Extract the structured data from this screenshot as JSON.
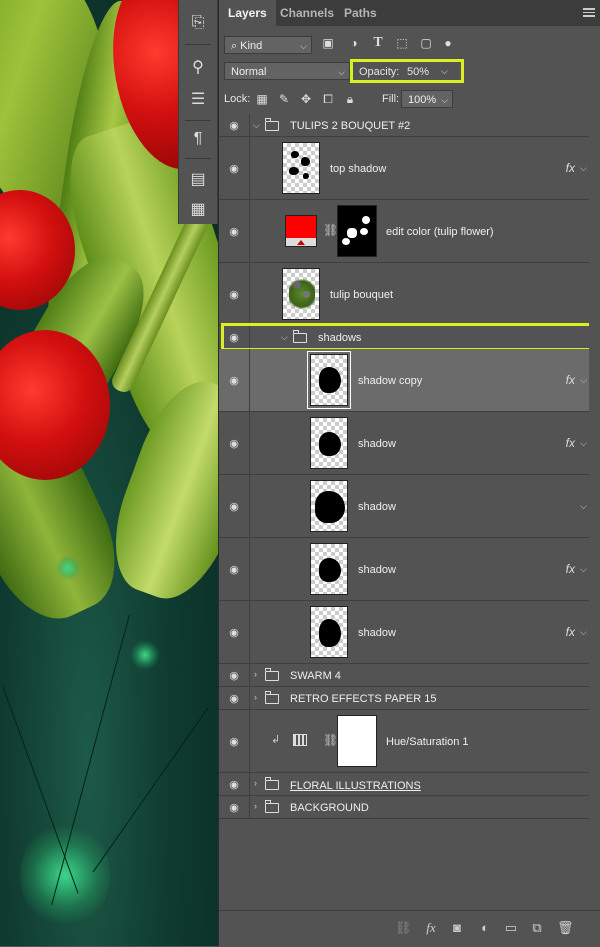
{
  "tabs": [
    {
      "label": "Layers",
      "active": true
    },
    {
      "label": "Channels",
      "active": false
    },
    {
      "label": "Paths",
      "active": false
    }
  ],
  "filter": {
    "kind_label": "Kind"
  },
  "blend": {
    "mode": "Normal",
    "opacity_label": "Opacity:",
    "opacity_value": "50%"
  },
  "lock": {
    "lock_label": "Lock:",
    "fill_label": "Fill:",
    "fill_value": "100%"
  },
  "layers": {
    "group_tulips": "TULIPS 2 BOUQUET #2",
    "top_shadow": "top shadow",
    "edit_color": "edit color (tulip flower)",
    "tulip_bouquet": "tulip bouquet",
    "group_shadows": "shadows",
    "shadow_copy": "shadow copy",
    "shadow_1": "shadow",
    "shadow_2": "shadow",
    "shadow_3": "shadow",
    "shadow_4": "shadow",
    "group_swarm": "SWARM 4",
    "group_retro": "RETRO EFFECTS PAPER 15",
    "hue_sat": "Hue/Saturation 1",
    "group_floral": "FLORAL ILLUSTRATIONS",
    "group_background": "BACKGROUND"
  },
  "fx_label": "fx",
  "colors": {
    "highlight": "#d9f020",
    "panel_bg": "#535353",
    "selected_row": "#6b6b6b",
    "swatch_red": "#ff0000"
  },
  "icons": [
    "eye-icon",
    "folder-icon",
    "link-icon",
    "fx-icon",
    "search-icon",
    "lock-icon",
    "trash-icon",
    "new-layer-icon",
    "mask-icon",
    "adjustment-icon"
  ]
}
